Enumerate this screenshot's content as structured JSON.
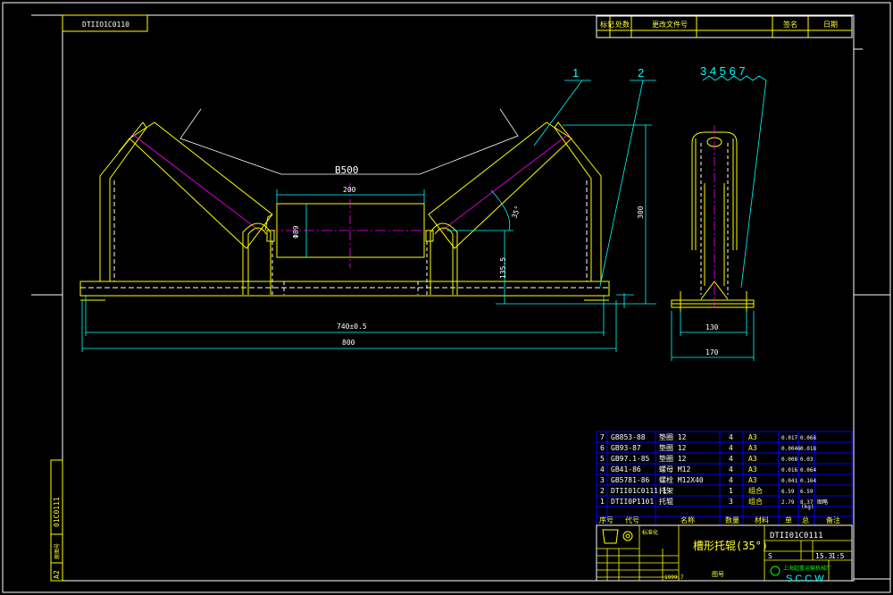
{
  "colors": {
    "background": "#000000",
    "frame": "#ffffff",
    "outline": "#ffff00",
    "dimension": "#00ffff",
    "center": "#ff00ff",
    "hidden": "#ffffff",
    "grid": "#0000ff"
  },
  "header": {
    "drawing_code_mirrored": "DTIIO1C0110",
    "revision_columns": [
      "标记",
      "处数",
      "更改文件号",
      "签名",
      "日期"
    ]
  },
  "main_view": {
    "label_belt": "B500",
    "dim_top": "200",
    "dim_diameter": "Φ89",
    "dim_height": "300",
    "dim_angle": "35°",
    "dim_low": "135.5",
    "dim_hole_span": "740±0.5",
    "dim_total": "800",
    "part_callouts": [
      "1",
      "2"
    ]
  },
  "side_view": {
    "callouts": "3 4 5 6 7",
    "dim_inner": "130",
    "dim_outer": "170"
  },
  "bom": {
    "rows": [
      {
        "no": "7",
        "code": "GB853-88",
        "name": "垫圈 12",
        "qty": "4",
        "mat": "A3",
        "unit": "0.017",
        "total": "0.068",
        "note": ""
      },
      {
        "no": "6",
        "code": "GB93-87",
        "name": "垫圈 12",
        "qty": "4",
        "mat": "A3",
        "unit": "0.0046",
        "total": "0.018",
        "note": ""
      },
      {
        "no": "5",
        "code": "GB97.1-85",
        "name": "垫圈 12",
        "qty": "4",
        "mat": "A3",
        "unit": "0.008",
        "total": "0.03",
        "note": ""
      },
      {
        "no": "4",
        "code": "GB41-86",
        "name": "螺母 M12",
        "qty": "4",
        "mat": "A3",
        "unit": "0.016",
        "total": "0.064",
        "note": ""
      },
      {
        "no": "3",
        "code": "GB5781-86",
        "name": "螺栓 M12X40",
        "qty": "4",
        "mat": "A3",
        "unit": "0.041",
        "total": "0.164",
        "note": ""
      },
      {
        "no": "2",
        "code": "DTII01C0111.1",
        "name": "托架",
        "qty": "1",
        "mat": "组合",
        "unit": "6.59",
        "total": "6.59",
        "note": ""
      },
      {
        "no": "1",
        "code": "DTII0P1101",
        "name": "托辊",
        "qty": "3",
        "mat": "组合",
        "unit": "2.79",
        "total": "8.37",
        "note": "图略"
      }
    ],
    "header": [
      "序号",
      "代号",
      "名称",
      "数量",
      "材料",
      "单",
      "总",
      "备注"
    ],
    "weight_unit": "(kg)"
  },
  "title_block": {
    "drawing_no": "DTII01C0111",
    "title": "槽形托辊(35°)",
    "mass": "15.3",
    "scale": "1:5",
    "stage": "S",
    "date": "1999.7",
    "company": "SCCW",
    "company_cn": "上海起重运输机械厂",
    "small_label": "标准化",
    "mid_label": "图号"
  },
  "left_strip": {
    "code": "01C0111",
    "note": "原图号",
    "size": "A2"
  }
}
